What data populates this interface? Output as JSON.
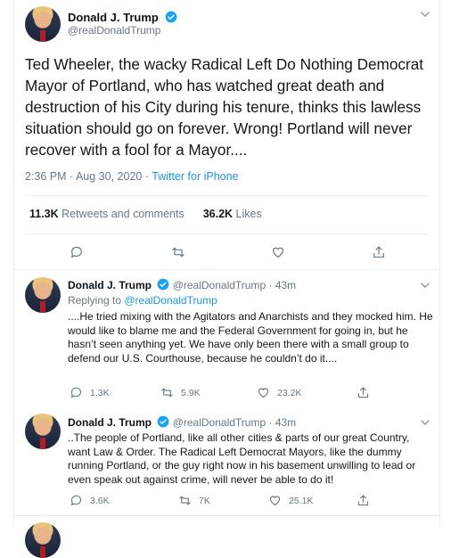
{
  "main_tweet": {
    "author_name": "Donald J. Trump",
    "author_handle": "@realDonaldTrump",
    "text": "Ted Wheeler, the wacky Radical Left Do Nothing Democrat Mayor of Portland, who has watched great death and destruction of his City during his tenure, thinks this lawless situation should go on forever. Wrong! Portland will never recover with a fool for a Mayor....",
    "timestamp": "2:36 PM · Aug 30, 2020 · ",
    "source": "Twitter for iPhone",
    "retweets_count": "11.3K",
    "retweets_label": "Retweets and comments",
    "likes_count": "36.2K",
    "likes_label": "Likes"
  },
  "replies": [
    {
      "author_name": "Donald J. Trump",
      "author_handle": "@realDonaldTrump",
      "time": " · 43m",
      "replying_label": "Replying to ",
      "replying_to": "@realDonaldTrump",
      "text": "....He tried mixing with the Agitators and Anarchists and they mocked him. He would like to blame me and the Federal Government for going in, but he hasn’t seen anything yet. We have only been there with a small group to defend our U.S. Courthouse, because he couldn’t do it....",
      "replies_count": "1.3K",
      "retweets_count": "5.9K",
      "likes_count": "23.2K"
    },
    {
      "author_name": "Donald J. Trump",
      "author_handle": "@realDonaldTrump",
      "time": " · 43m",
      "text": "..The people of Portland, like all other cities &  parts of our great Country, want Law & Order. The Radical Left Democrat Mayors, like the dummy running Portland, or the guy right now in his basement unwilling to lead or even speak out against crime, will never be able to do it!",
      "replies_count": "3.6K",
      "retweets_count": "7K",
      "likes_count": "25.1K"
    }
  ],
  "colors": {
    "accent": "#1b95e0",
    "muted": "#657786",
    "border": "#e6ecf0"
  },
  "icons": [
    "verified-icon",
    "chevron-down-icon",
    "reply-icon",
    "retweet-icon",
    "like-icon",
    "share-icon"
  ]
}
